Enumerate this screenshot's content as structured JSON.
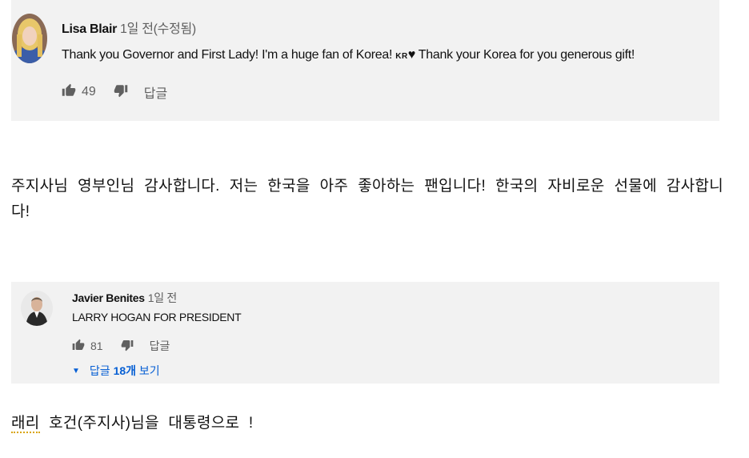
{
  "comment1": {
    "author": "Lisa Blair",
    "time": "1일 전(수정됨)",
    "text_before": "Thank you Governor and First Lady! I'm a huge fan of Korea! ",
    "flag": "KR",
    "text_after": "♥ Thank your Korea for you generous gift!",
    "likes": "49",
    "reply_label": "답글"
  },
  "translation1": "주지사님 영부인님 감사합니다. 저는 한국을 아주 좋아하는 팬입니다! 한국의 자비로운 선물에 감사합니다!",
  "comment2": {
    "author": "Javier Benites",
    "time": "1일 전",
    "text": "LARRY HOGAN FOR PRESIDENT",
    "likes": "81",
    "reply_label": "답글",
    "view_replies_prefix": "답글 ",
    "view_replies_count": "18개",
    "view_replies_suffix": " 보기"
  },
  "translation2": {
    "first_word": "래리",
    "rest": " 호건(주지사)님을 대통령으로 !"
  }
}
